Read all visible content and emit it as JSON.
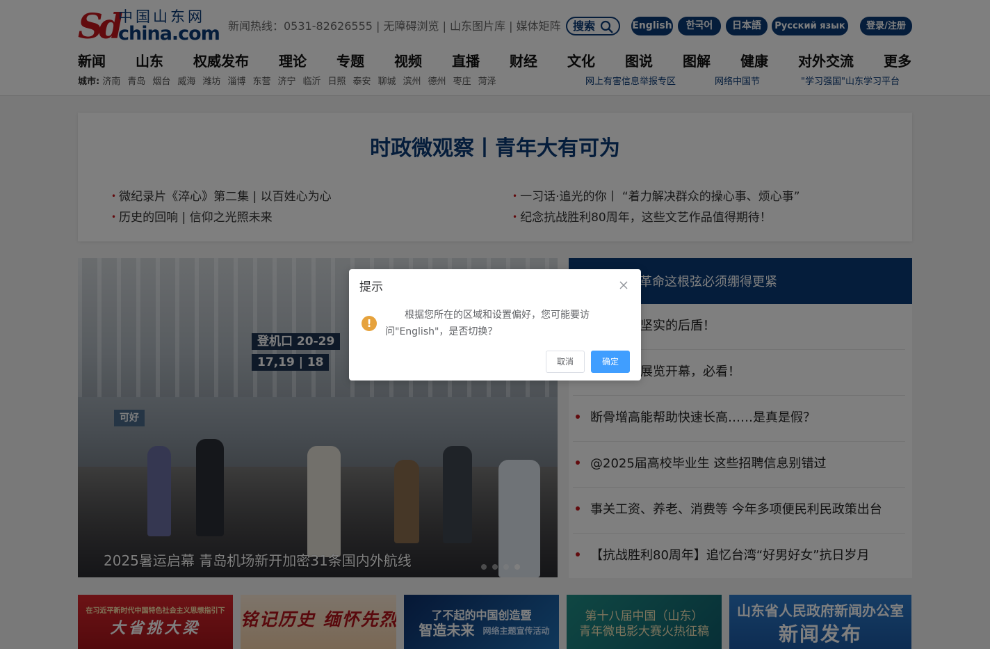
{
  "logo": {
    "mark": "Sd",
    "chinese": "中国山东网",
    "domain": "china.com"
  },
  "topbar": {
    "hotline": "新闻热线：0531-82626555 | 无障碍浏览 | 山东图片库 | 媒体矩阵",
    "search_label": "搜索",
    "languages": [
      "English",
      "한국어",
      "日本語",
      "Русский язык"
    ],
    "login_label": "登录/注册"
  },
  "nav": [
    "新闻",
    "山东",
    "权威发布",
    "理论",
    "专题",
    "视频",
    "直播",
    "财经",
    "文化",
    "图说",
    "图解",
    "健康",
    "对外交流",
    "更多"
  ],
  "cities": {
    "label": "城市:",
    "items": [
      "济南",
      "青岛",
      "烟台",
      "威海",
      "潍坊",
      "淄博",
      "东营",
      "济宁",
      "临沂",
      "日照",
      "泰安",
      "聊城",
      "滨州",
      "德州",
      "枣庄",
      "菏泽"
    ]
  },
  "quick_links": [
    "网上有害信息举报专区",
    "网络中国节",
    "\"学习强国\"山东学习平台"
  ],
  "headline": {
    "title": "时政微观察丨青年大有可为",
    "items": [
      "微纪录片《淬心》第二集 | 以百姓心为心",
      "一习话·追光的你丨 “着力解决群众的操心事、烦心事”",
      "历史的回响 | 信仰之光照未来",
      "纪念抗战胜利80周年，这些文艺作品值得期待！"
    ]
  },
  "slideshow": {
    "caption": "2025暑运启幕 青岛机场新开加密31条国内外航线",
    "signs": [
      "登机口 20-29",
      "17,19 | 18",
      "可好"
    ],
    "dots": 4,
    "active_dot": 4
  },
  "right_list": {
    "head": "革命这根弦必须绷得更紧",
    "items": [
      "影，就是坚实的后盾！",
      "这场主题展览开幕，必看！",
      "断骨增高能帮助快速长高……是真是假？",
      "@2025届高校毕业生 这些招聘信息别错过",
      "事关工资、养老、消费等 今年多项便民利民政策出台",
      "【抗战胜利80周年】追忆台湾“好男好女”抗日岁月"
    ]
  },
  "banners": [
    {
      "small": "在习近平新时代中国特色社会主义思想指引下",
      "big": "大省挑大梁"
    },
    {
      "big": "铭记历史 缅怀先烈"
    },
    {
      "small": "了不起的中国创造暨",
      "big": "智造未来",
      "tail": "网络主题宣传活动"
    },
    {
      "small": "第十八届中国（山东）",
      "big": "青年微电影大赛火热征稿"
    },
    {
      "small": "山东省人民政府新闻办公室",
      "big": "新闻发布"
    }
  ],
  "dialog": {
    "title": "提示",
    "message": "根据您所在的区域和设置偏好，您可能要访问\"English\"，是否切换？",
    "cancel_label": "取消",
    "confirm_label": "确定"
  },
  "colors": {
    "brand_blue": "#0b3a77",
    "brand_red": "#c5161d",
    "ok_blue": "#409eff",
    "warning": "#e6a23c"
  }
}
